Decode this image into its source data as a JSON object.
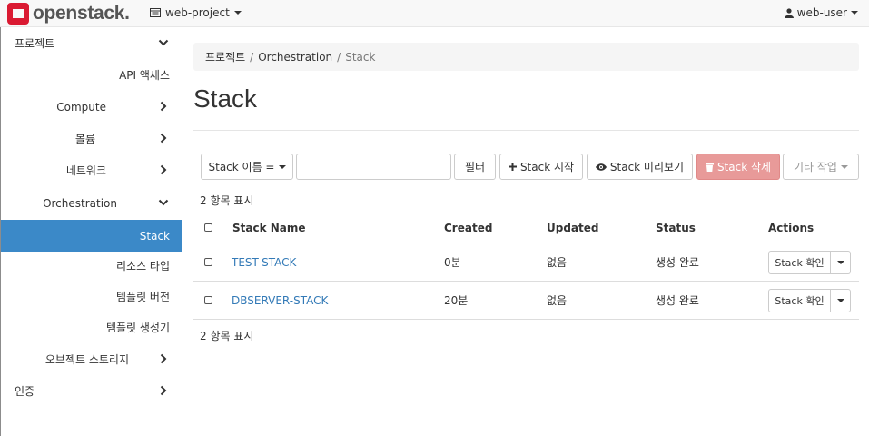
{
  "brand": {
    "name": "openstack."
  },
  "topbar": {
    "project": "web-project",
    "user": "web-user"
  },
  "sidebar": {
    "items": [
      {
        "label": "프로젝트",
        "state": "expanded"
      },
      {
        "label": "API 액세스"
      },
      {
        "label": "Compute",
        "state": "collapsed"
      },
      {
        "label": "볼륨",
        "state": "collapsed"
      },
      {
        "label": "네트워크",
        "state": "collapsed"
      },
      {
        "label": "Orchestration",
        "state": "expanded"
      },
      {
        "label": "Stack",
        "state": "active"
      },
      {
        "label": "리소스 타입"
      },
      {
        "label": "템플릿 버전"
      },
      {
        "label": "템플릿 생성기"
      },
      {
        "label": "오브젝트 스토리지",
        "state": "collapsed"
      },
      {
        "label": "인증",
        "state": "collapsed"
      }
    ]
  },
  "breadcrumb": [
    "프로젝트",
    "Orchestration",
    "Stack"
  ],
  "page": {
    "title": "Stack"
  },
  "toolbar": {
    "filter_select": "Stack 이름 =",
    "search_value": "",
    "filter_button": "필터",
    "launch_button": "Stack 시작",
    "preview_button": "Stack 미리보기",
    "delete_button": "Stack 삭제",
    "more_button": "기타 작업"
  },
  "table": {
    "count_top": "2 항목 표시",
    "count_bottom": "2 항목 표시",
    "headers": [
      "Stack Name",
      "Created",
      "Updated",
      "Status",
      "Actions"
    ],
    "rows": [
      {
        "name": "TEST-STACK",
        "created": "0분",
        "updated": "없음",
        "status": "생성 완료",
        "action": "Stack 확인"
      },
      {
        "name": "DBSERVER-STACK",
        "created": "20분",
        "updated": "없음",
        "status": "생성 완료",
        "action": "Stack 확인"
      }
    ]
  },
  "colors": {
    "accent": "#3b89c8",
    "link": "#337ab7",
    "danger": "#e89a99",
    "brand": "#da1a32"
  }
}
